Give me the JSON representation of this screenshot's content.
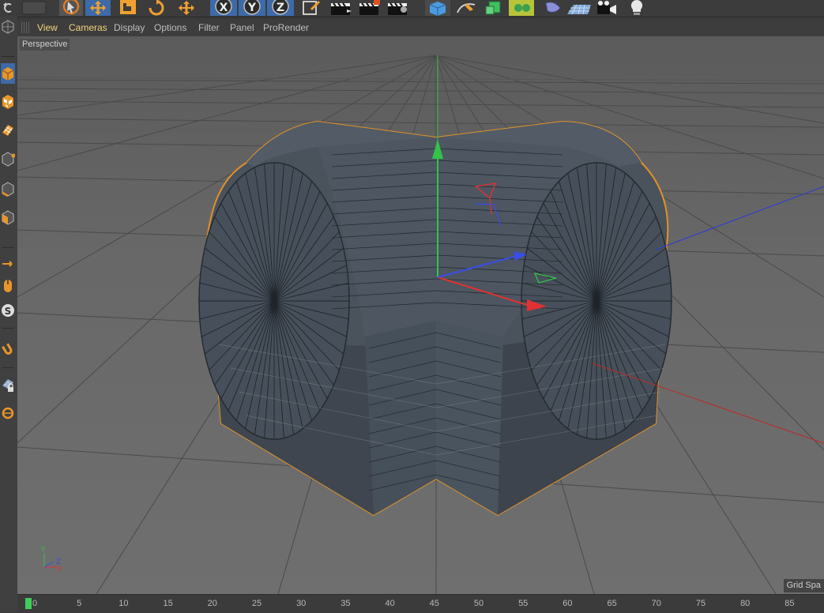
{
  "toolbar": {
    "buttons": [
      {
        "name": "undo-icon"
      },
      {
        "name": "redo-icon"
      },
      {
        "name": "live-selection-icon"
      },
      {
        "name": "move-tool-icon"
      },
      {
        "name": "scale-tool-icon"
      },
      {
        "name": "rotate-tool-icon"
      },
      {
        "name": "recent-tools-icon"
      },
      {
        "name": "x-axis-lock-icon"
      },
      {
        "name": "y-axis-lock-icon"
      },
      {
        "name": "z-axis-lock-icon"
      },
      {
        "name": "coordinate-system-icon"
      },
      {
        "name": "render-view-icon"
      },
      {
        "name": "render-picture-viewer-icon"
      },
      {
        "name": "render-settings-icon"
      },
      {
        "name": "cube-primitive-icon"
      },
      {
        "name": "pen-spline-icon"
      },
      {
        "name": "subdivision-surface-icon"
      },
      {
        "name": "array-generator-icon"
      },
      {
        "name": "deformer-icon"
      },
      {
        "name": "floor-object-icon"
      },
      {
        "name": "camera-object-icon"
      },
      {
        "name": "light-object-icon"
      }
    ]
  },
  "viewport_menu": {
    "items": [
      "View",
      "Cameras",
      "Display",
      "Options",
      "Filter",
      "Panel",
      "ProRender"
    ],
    "active": "View"
  },
  "viewport": {
    "camera_label": "Perspective",
    "grid_spacing_label": "Grid Spa",
    "selection_color": "#e0912a"
  },
  "axes": {
    "x_color": "#e03232",
    "y_color": "#33c24a",
    "z_color": "#3a4de6",
    "corner_labels": {
      "y": "Y",
      "z": "Z",
      "x": "X"
    }
  },
  "timeline": {
    "ticks": [
      "0",
      "5",
      "10",
      "15",
      "20",
      "25",
      "30",
      "35",
      "40",
      "45",
      "50",
      "55",
      "60",
      "65",
      "70",
      "75",
      "80",
      "85"
    ],
    "current_frame": 0
  },
  "leftbar": {
    "tools": [
      "make-editable-icon",
      "model-mode-icon",
      "texture-mode-icon",
      "workplane-icon",
      "points-mode-icon",
      "edges-mode-icon",
      "polygons-mode-icon",
      "axis-mode-icon",
      "tweak-mode-icon",
      "soft-selection-icon",
      "snap-icon",
      "locked-workplane-icon",
      "planar-workplane-icon"
    ]
  }
}
